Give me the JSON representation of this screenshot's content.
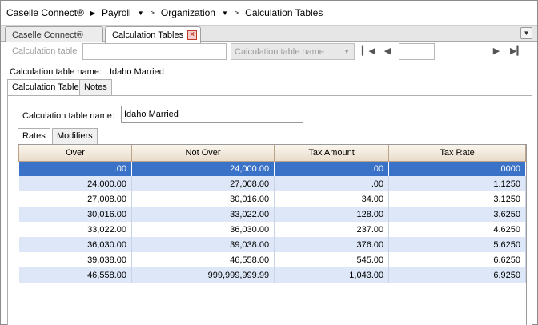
{
  "breadcrumb": {
    "items": [
      {
        "label": "Caselle Connect®",
        "has_caret": false
      },
      {
        "label": "Payroll",
        "has_caret": true
      },
      {
        "label": "Organization",
        "has_caret": true
      },
      {
        "label": "Calculation Tables",
        "has_caret": false
      }
    ]
  },
  "tabs": [
    {
      "label": "Caselle Connect®",
      "active": false
    },
    {
      "label": "Calculation Tables",
      "active": true
    }
  ],
  "toolbar": {
    "label": "Calculation table",
    "search_value": "",
    "select_placeholder": "Calculation table name",
    "page_value": ""
  },
  "header": {
    "name_label": "Calculation table name:",
    "name_value": "Idaho Married"
  },
  "inner_tabs": [
    {
      "label": "Calculation Table",
      "active": true
    },
    {
      "label": "Notes",
      "active": false
    }
  ],
  "form": {
    "name_label": "Calculation table name:",
    "name_value": "Idaho Married"
  },
  "sub_tabs": [
    {
      "label": "Rates",
      "active": true
    },
    {
      "label": "Modifiers",
      "active": false
    }
  ],
  "grid": {
    "columns": [
      "Over",
      "Not Over",
      "Tax Amount",
      "Tax Rate"
    ],
    "rows": [
      [
        ".00",
        "24,000.00",
        ".00",
        ".0000"
      ],
      [
        "24,000.00",
        "27,008.00",
        ".00",
        "1.1250"
      ],
      [
        "27,008.00",
        "30,016.00",
        "34.00",
        "3.1250"
      ],
      [
        "30,016.00",
        "33,022.00",
        "128.00",
        "3.6250"
      ],
      [
        "33,022.00",
        "36,030.00",
        "237.00",
        "4.6250"
      ],
      [
        "36,030.00",
        "39,038.00",
        "376.00",
        "5.6250"
      ],
      [
        "39,038.00",
        "46,558.00",
        "545.00",
        "6.6250"
      ],
      [
        "46,558.00",
        "999,999,999.99",
        "1,043.00",
        "6.9250"
      ]
    ],
    "selected_row": 0
  },
  "colors": {
    "selection": "#3a72c8",
    "alt_row": "#dde7f7",
    "header_bg": "#e9dccb"
  }
}
